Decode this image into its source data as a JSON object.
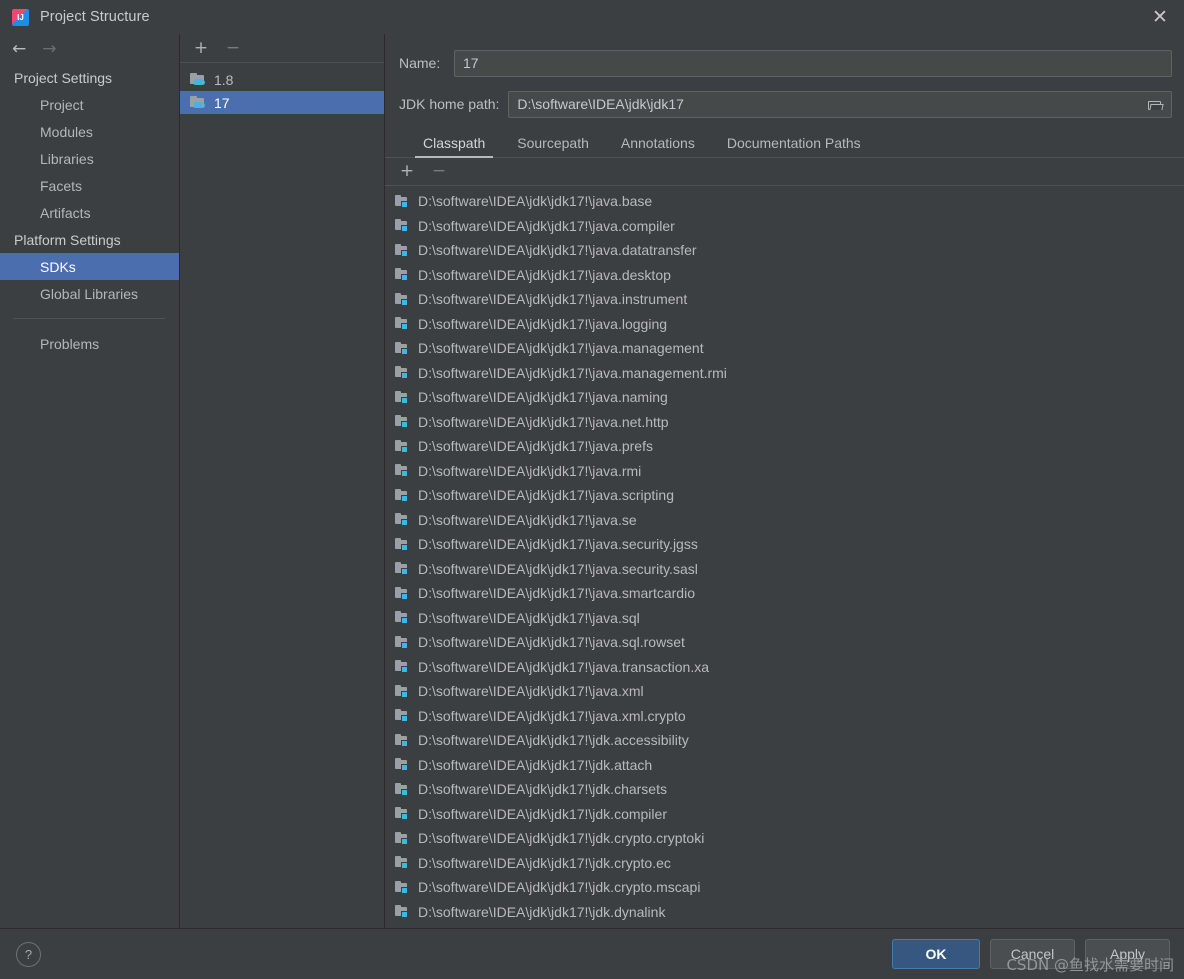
{
  "window": {
    "title": "Project Structure",
    "logo_icon": "intellij-idea-logo",
    "close_icon": "✕"
  },
  "nav": {
    "back_icon": "←",
    "forward_icon": "→"
  },
  "sidebar": {
    "groups": [
      {
        "header": "Project Settings",
        "items": [
          {
            "label": "Project",
            "selected": false
          },
          {
            "label": "Modules",
            "selected": false
          },
          {
            "label": "Libraries",
            "selected": false
          },
          {
            "label": "Facets",
            "selected": false
          },
          {
            "label": "Artifacts",
            "selected": false
          }
        ]
      },
      {
        "header": "Platform Settings",
        "items": [
          {
            "label": "SDKs",
            "selected": true
          },
          {
            "label": "Global Libraries",
            "selected": false
          }
        ]
      }
    ],
    "problems_label": "Problems"
  },
  "sdk_panel": {
    "add_label": "+",
    "remove_label": "−",
    "items": [
      {
        "label": "1.8",
        "selected": false
      },
      {
        "label": "17",
        "selected": true
      }
    ]
  },
  "form": {
    "name_label": "Name:",
    "name_value": "17",
    "jdk_path_label": "JDK home path:",
    "jdk_path_value": "D:\\software\\IDEA\\jdk\\jdk17",
    "browse_icon": "open-folder-icon"
  },
  "tabs": [
    {
      "label": "Classpath",
      "active": true
    },
    {
      "label": "Sourcepath",
      "active": false
    },
    {
      "label": "Annotations",
      "active": false
    },
    {
      "label": "Documentation Paths",
      "active": false
    }
  ],
  "classpath_toolbar": {
    "add_label": "+",
    "remove_label": "−"
  },
  "classpath": {
    "entries": [
      "D:\\software\\IDEA\\jdk\\jdk17!\\java.base",
      "D:\\software\\IDEA\\jdk\\jdk17!\\java.compiler",
      "D:\\software\\IDEA\\jdk\\jdk17!\\java.datatransfer",
      "D:\\software\\IDEA\\jdk\\jdk17!\\java.desktop",
      "D:\\software\\IDEA\\jdk\\jdk17!\\java.instrument",
      "D:\\software\\IDEA\\jdk\\jdk17!\\java.logging",
      "D:\\software\\IDEA\\jdk\\jdk17!\\java.management",
      "D:\\software\\IDEA\\jdk\\jdk17!\\java.management.rmi",
      "D:\\software\\IDEA\\jdk\\jdk17!\\java.naming",
      "D:\\software\\IDEA\\jdk\\jdk17!\\java.net.http",
      "D:\\software\\IDEA\\jdk\\jdk17!\\java.prefs",
      "D:\\software\\IDEA\\jdk\\jdk17!\\java.rmi",
      "D:\\software\\IDEA\\jdk\\jdk17!\\java.scripting",
      "D:\\software\\IDEA\\jdk\\jdk17!\\java.se",
      "D:\\software\\IDEA\\jdk\\jdk17!\\java.security.jgss",
      "D:\\software\\IDEA\\jdk\\jdk17!\\java.security.sasl",
      "D:\\software\\IDEA\\jdk\\jdk17!\\java.smartcardio",
      "D:\\software\\IDEA\\jdk\\jdk17!\\java.sql",
      "D:\\software\\IDEA\\jdk\\jdk17!\\java.sql.rowset",
      "D:\\software\\IDEA\\jdk\\jdk17!\\java.transaction.xa",
      "D:\\software\\IDEA\\jdk\\jdk17!\\java.xml",
      "D:\\software\\IDEA\\jdk\\jdk17!\\java.xml.crypto",
      "D:\\software\\IDEA\\jdk\\jdk17!\\jdk.accessibility",
      "D:\\software\\IDEA\\jdk\\jdk17!\\jdk.attach",
      "D:\\software\\IDEA\\jdk\\jdk17!\\jdk.charsets",
      "D:\\software\\IDEA\\jdk\\jdk17!\\jdk.compiler",
      "D:\\software\\IDEA\\jdk\\jdk17!\\jdk.crypto.cryptoki",
      "D:\\software\\IDEA\\jdk\\jdk17!\\jdk.crypto.ec",
      "D:\\software\\IDEA\\jdk\\jdk17!\\jdk.crypto.mscapi",
      "D:\\software\\IDEA\\jdk\\jdk17!\\jdk.dynalink"
    ]
  },
  "footer": {
    "help_label": "?",
    "ok_label": "OK",
    "cancel_label": "Cancel",
    "apply_label": "Apply",
    "watermark": "CSDN @鱼找水需要时间"
  },
  "colors": {
    "background": "#3c3f41",
    "selection": "#4b6eaf",
    "primary_button": "#365880",
    "icon_accent": "#3fb6e3"
  }
}
